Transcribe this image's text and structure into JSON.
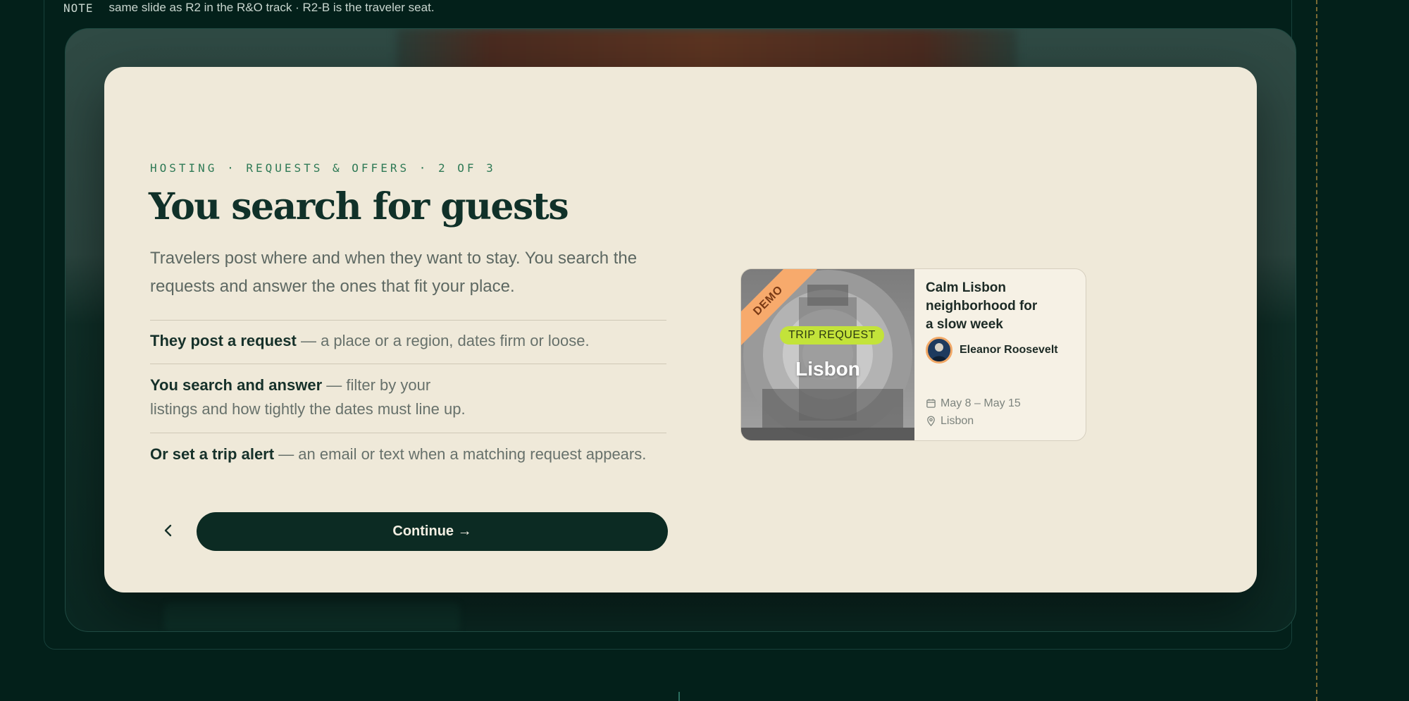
{
  "note": {
    "tag": "NOTE",
    "text": "same slide as R2 in the R&O track · R2-B is the traveler seat."
  },
  "modal": {
    "eyebrow": "HOSTING · REQUESTS & OFFERS · 2 OF 3",
    "title": "You search for guests",
    "lede": "Travelers post where and when they want to stay. You search the requests and answer the ones that fit your place.",
    "points": [
      {
        "bold": "They post a request",
        "rest": " — a place or a region, dates firm or loose."
      },
      {
        "bold": "You search and answer",
        "rest": " — filter by your",
        "rest2": "listings and how tightly the dates must line up."
      },
      {
        "bold": "Or set a trip alert",
        "rest": " — an email or text when a matching request appears."
      }
    ],
    "continue_label": "Continue →",
    "back_icon": "chevron-left-icon"
  },
  "card": {
    "ribbon": "DEMO",
    "pill": "TRIP REQUEST",
    "city": "Lisbon",
    "title": "Calm Lisbon neighborhood for a slow week",
    "host_name": "Eleanor Roosevelt",
    "dates": "May 8 – May 15",
    "location": "Lisbon"
  },
  "colors": {
    "page_bg": "#03201a",
    "modal_bg": "#efe9d9",
    "primary": "#0c2b23",
    "eyebrow": "#2f7a56",
    "pill": "#c3e33a",
    "ribbon": "#f7aa6c"
  }
}
